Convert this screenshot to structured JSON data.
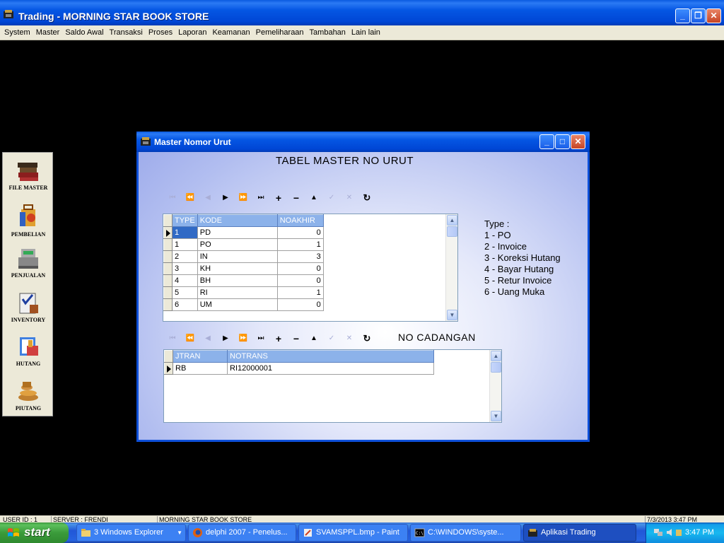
{
  "app": {
    "title": "Trading - MORNING STAR BOOK STORE",
    "minimize": "_",
    "restore": "❐",
    "close": "✕"
  },
  "menu": [
    "System",
    "Master",
    "Saldo Awal",
    "Transaksi",
    "Proses",
    "Laporan",
    "Keamanan",
    "Pemeliharaan",
    "Tambahan",
    "Lain lain"
  ],
  "sidepanel": {
    "items": [
      "FILE MASTER",
      "PEMBELIAN",
      "PENJUALAN",
      "INVENTORY",
      "HUTANG",
      "PIUTANG"
    ]
  },
  "child": {
    "title": "Master Nomor Urut",
    "heading": "TABEL MASTER NO URUT",
    "heading2": "NO CADANGAN",
    "nav_glyphs": [
      "⏮",
      "⏪",
      "◀",
      "▶",
      "⏩",
      "⏭",
      "+",
      "−",
      "▲",
      "✓",
      "✕",
      "↻"
    ],
    "grid1": {
      "columns": [
        "TYPE",
        "KODE",
        "NOAKHIR"
      ],
      "rows": [
        [
          "1",
          "PD",
          "0"
        ],
        [
          "1",
          "PO",
          "1"
        ],
        [
          "2",
          "IN",
          "3"
        ],
        [
          "3",
          "KH",
          "0"
        ],
        [
          "4",
          "BH",
          "0"
        ],
        [
          "5",
          "RI",
          "1"
        ],
        [
          "6",
          "UM",
          "0"
        ]
      ]
    },
    "grid2": {
      "columns": [
        "JTRAN",
        "NOTRANS"
      ],
      "rows": [
        [
          "RB",
          "RI12000001"
        ]
      ]
    },
    "type_legend": {
      "label": "Type :",
      "items": [
        "1 - PO",
        "2 - Invoice",
        "3 - Koreksi Hutang",
        "4 - Bayar Hutang",
        "5 - Retur Invoice",
        "6 - Uang Muka"
      ]
    }
  },
  "statusbar": [
    "USER ID : 1",
    "SERVER : FRENDI",
    "MORNING STAR BOOK STORE",
    "7/3/2013 3:47 PM"
  ],
  "taskbar": {
    "start": "start",
    "items": [
      "3 Windows Explorer",
      "delphi 2007 - Penelus...",
      "SVAMSPPL.bmp - Paint",
      "C:\\WINDOWS\\syste...",
      "Aplikasi Trading"
    ],
    "clock": "3:47 PM"
  },
  "colors": {
    "titlebar_blue": "#0556e3",
    "header_blue": "#8cb2ea",
    "selection": "#316ac5",
    "start_green": "#3b9b3b"
  }
}
